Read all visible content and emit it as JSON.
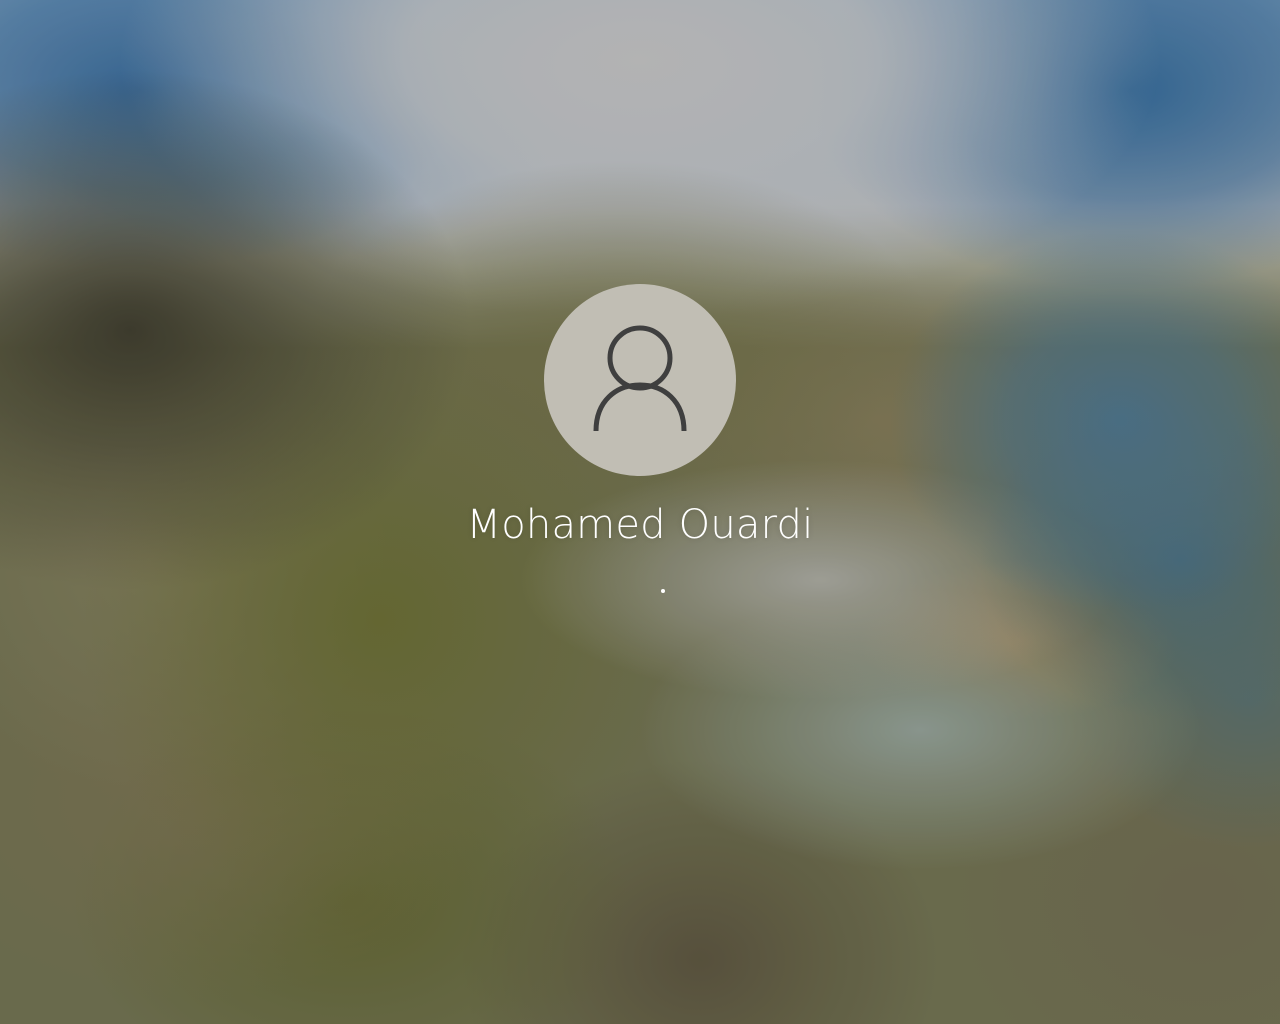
{
  "screen": {
    "type": "windows-sign-in",
    "background": "blurred-coastal-landscape"
  },
  "account": {
    "display_name": "Mohamed Ouardi",
    "avatar_icon": "user-silhouette-icon"
  },
  "status": {
    "indicator": "loading-dots-progress"
  },
  "colors": {
    "avatar_bg": "#c1beb4",
    "avatar_glyph": "#3f3f3f",
    "text": "#ffffff"
  }
}
